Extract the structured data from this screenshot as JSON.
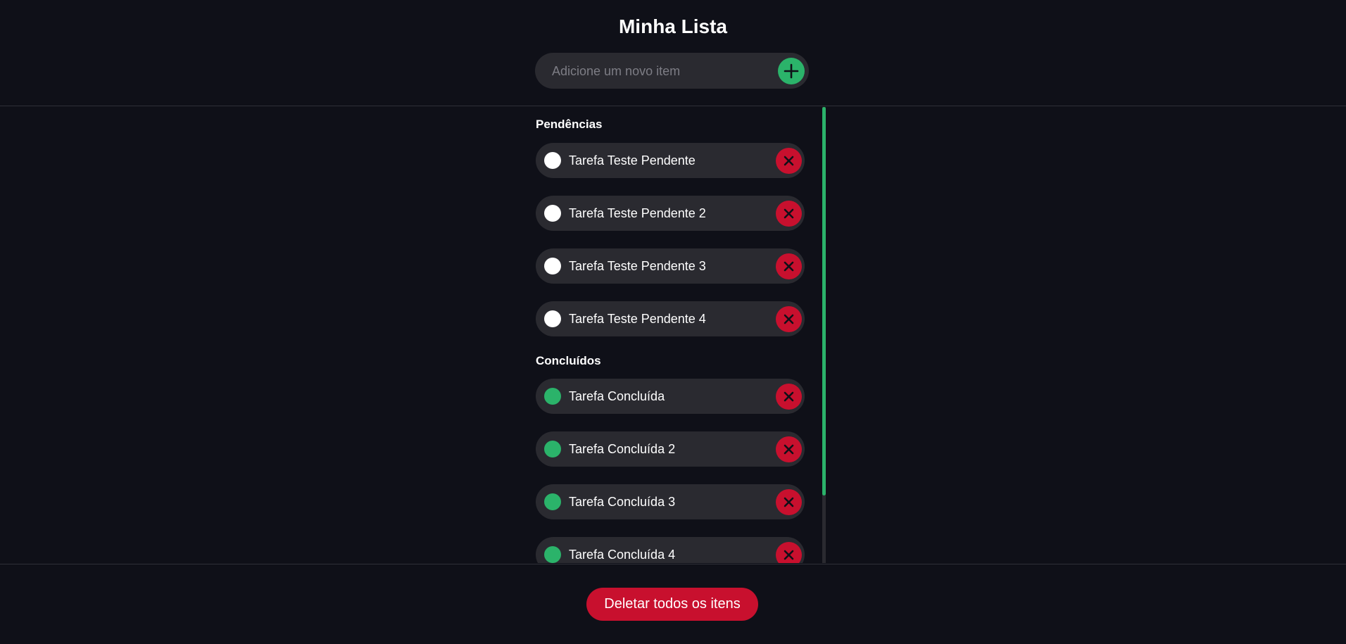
{
  "header": {
    "title": "Minha Lista",
    "input_placeholder": "Adicione um novo item",
    "input_value": "",
    "add_icon": "plus-icon"
  },
  "pending": {
    "title": "Pendências",
    "items": [
      {
        "label": "Tarefa Teste Pendente"
      },
      {
        "label": "Tarefa Teste Pendente 2"
      },
      {
        "label": "Tarefa Teste Pendente 3"
      },
      {
        "label": "Tarefa Teste Pendente 4"
      }
    ]
  },
  "done": {
    "title": "Concluídos",
    "items": [
      {
        "label": "Tarefa Concluída"
      },
      {
        "label": "Tarefa Concluída 2"
      },
      {
        "label": "Tarefa Concluída 3"
      },
      {
        "label": "Tarefa Concluída 4"
      }
    ]
  },
  "footer": {
    "delete_all_label": "Deletar todos os itens"
  },
  "colors": {
    "background": "#0f1018",
    "surface": "#2a2a30",
    "accent_green": "#2bb36a",
    "danger_red": "#c8102e"
  },
  "icons": {
    "delete": "close-icon",
    "pending_check": "circle-unchecked-icon",
    "done_check": "circle-checked-icon"
  }
}
